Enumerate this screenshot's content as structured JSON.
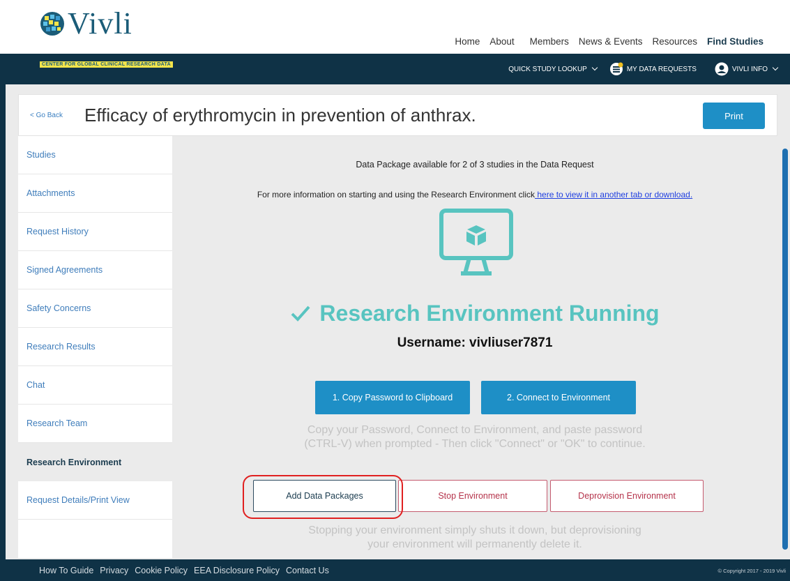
{
  "brand": {
    "name": "Vivli",
    "tagline": "CENTER FOR GLOBAL CLINICAL RESEARCH DATA"
  },
  "topnav": [
    "Home",
    "About",
    "Members",
    "News & Events",
    "Resources",
    "Find Studies"
  ],
  "subnav": {
    "quick_lookup": "QUICK STUDY LOOKUP",
    "data_requests": "MY DATA REQUESTS",
    "user": "VIVLI INFO"
  },
  "page": {
    "go_back": "< Go Back",
    "title": "Efficacy of erythromycin in prevention of anthrax.",
    "print": "Print"
  },
  "sidebar": {
    "items": [
      "Studies",
      "Attachments",
      "Request History",
      "Signed Agreements",
      "Safety Concerns",
      "Research Results",
      "Chat",
      "Research Team",
      "Research Environment",
      "Request Details/Print View"
    ],
    "active": "Research Environment"
  },
  "content": {
    "availability": "Data Package available for 2 of 3 studies in the Data Request",
    "info_prefix": "For more information on starting and using the Research Environment click",
    "info_link": " here to view it in another tab or download.",
    "status": "Research Environment Running",
    "username": "Username: vivliuser7871",
    "copy_password": "1. Copy Password to Clipboard",
    "connect": "2. Connect to Environment",
    "connect_hint_1": "Copy your Password, Connect to Environment, and paste password",
    "connect_hint_2": "(CTRL-V) when prompted - Then click \"Connect\" or \"OK\" to continue.",
    "add_packages": "Add Data Packages",
    "stop": "Stop Environment",
    "deprovision": "Deprovision Environment",
    "stop_hint_1": "Stopping your environment simply shuts it down, but deprovisioning",
    "stop_hint_2": "your environment will permanently delete it."
  },
  "footer": {
    "links": [
      "How To Guide",
      "Privacy",
      "Cookie Policy",
      "EEA Disclosure Policy",
      "Contact Us"
    ],
    "copyright": "© Copyright 2017 - 2019 Vivli"
  },
  "colors": {
    "navy": "#0f3246",
    "accent_blue": "#1e8fc6",
    "teal": "#58c4c0",
    "danger": "#b5334b",
    "highlight": "#e02020"
  },
  "icons": [
    "logo-mark-icon",
    "chevron-down-icon",
    "data-requests-icon",
    "user-avatar-icon",
    "monitor-cube-icon",
    "checkmark-icon"
  ]
}
